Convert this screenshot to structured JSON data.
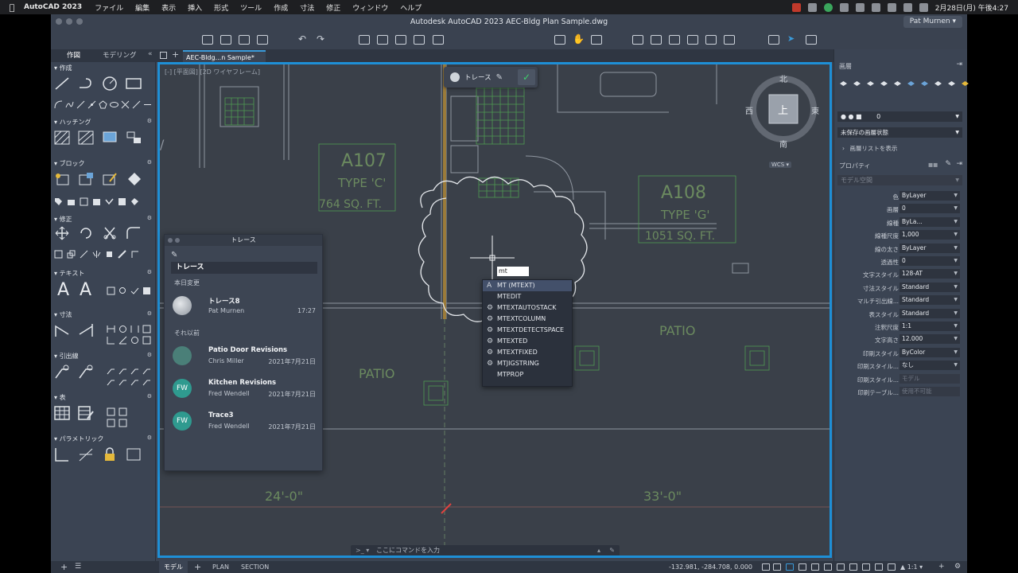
{
  "menubar": {
    "app_name": "AutoCAD 2023",
    "items": [
      "ファイル",
      "編集",
      "表示",
      "挿入",
      "形式",
      "ツール",
      "作成",
      "寸法",
      "修正",
      "ウィンドウ",
      "ヘルプ"
    ],
    "datetime": "2月28日(月) 午後4:27"
  },
  "window": {
    "title": "Autodesk AutoCAD 2023   AEC-Bldg Plan Sample.dwg",
    "user": "Pat Murnen"
  },
  "left_panel": {
    "tabs": [
      "作図",
      "モデリング"
    ],
    "sections": [
      "作成",
      "ハッチング",
      "ブロック",
      "修正",
      "テキスト",
      "寸法",
      "引出線",
      "表",
      "パラメトリック"
    ]
  },
  "doc_tab": {
    "label": "AEC-Bldg...n Sample*"
  },
  "viewport": {
    "label": "[-] [平面図] [2D ワイヤフレーム]"
  },
  "trace_popup": {
    "label": "トレース"
  },
  "drawing": {
    "rooms": [
      {
        "id": "A107",
        "type": "TYPE 'C'",
        "area": "764 SQ. FT."
      },
      {
        "id": "A108",
        "type": "TYPE 'G'",
        "area": "1051 SQ. FT."
      }
    ],
    "patio_labels": [
      "PATIO",
      "PATIO"
    ],
    "dimensions": [
      "24'-0\"",
      "33'-0\""
    ]
  },
  "trace_panel": {
    "header": "トレース",
    "title": "トレース",
    "group_today": "本日変更",
    "group_earlier": "それ以前",
    "items": [
      {
        "name": "トレース8",
        "user": "Pat Murnen",
        "date": "17:27",
        "avatar": ""
      },
      {
        "name": "Patio Door Revisions",
        "user": "Chris Miller",
        "date": "2021年7月21日",
        "avatar": ""
      },
      {
        "name": "Kitchen Revisions",
        "user": "Fred Wendell",
        "date": "2021年7月21日",
        "avatar": "FW"
      },
      {
        "name": "Trace3",
        "user": "Fred Wendell",
        "date": "2021年7月21日",
        "avatar": "FW"
      }
    ]
  },
  "command": {
    "typed": "mt",
    "suggestions": [
      "MT (MTEXT)",
      "MTEDIT",
      "MTEXTAUTOSTACK",
      "MTEXTCOLUMN",
      "MTEXTDETECTSPACE",
      "MTEXTED",
      "MTEXTFIXED",
      "MTJIGSTRING",
      "MTPROP"
    ],
    "selected_index": 0,
    "placeholder": "ここにコマンドを入力"
  },
  "nav_cube": {
    "north": "北",
    "south": "南",
    "east": "東",
    "west": "西",
    "face": "上",
    "wcs": "WCS"
  },
  "right_panel": {
    "layer_label": "画層",
    "layer_value": "0",
    "layer_state": "未保存の画層状態",
    "layer_list": "画層リストを表示",
    "properties_title": "プロパティ",
    "object_type": "モデル空間",
    "properties": [
      {
        "label": "色",
        "value": "ByLayer",
        "dim": false
      },
      {
        "label": "画層",
        "value": "0",
        "dim": false
      },
      {
        "label": "線種",
        "value": "ByLa...",
        "dim": false
      },
      {
        "label": "線種尺度",
        "value": "1,000",
        "dim": false
      },
      {
        "label": "線の太さ",
        "value": "ByLayer",
        "dim": false
      },
      {
        "label": "透過性",
        "value": "0",
        "dim": false
      },
      {
        "label": "文字スタイル",
        "value": "128-AT",
        "dim": false
      },
      {
        "label": "寸法スタイル",
        "value": "Standard",
        "dim": false
      },
      {
        "label": "マルチ引出線...",
        "value": "Standard",
        "dim": false
      },
      {
        "label": "表スタイル",
        "value": "Standard",
        "dim": false
      },
      {
        "label": "注釈尺度",
        "value": "1:1",
        "dim": false
      },
      {
        "label": "文字高さ",
        "value": "12.000",
        "dim": false
      },
      {
        "label": "印刷スタイル",
        "value": "ByColor",
        "dim": false
      },
      {
        "label": "印刷スタイル...",
        "value": "なし",
        "dim": false
      },
      {
        "label": "印刷スタイル...",
        "value": "モデル",
        "dim": true
      },
      {
        "label": "印刷テーブル...",
        "value": "使用不可能",
        "dim": true
      }
    ]
  },
  "status": {
    "tabs": [
      "モデル",
      "PLAN",
      "SECTION"
    ],
    "coordinates": "-132.981, -284.708, 0.000",
    "scale": "1:1"
  },
  "colors": {
    "accent": "#1e8fd6",
    "panel": "#3b4453",
    "canvas": "#3a4049"
  }
}
